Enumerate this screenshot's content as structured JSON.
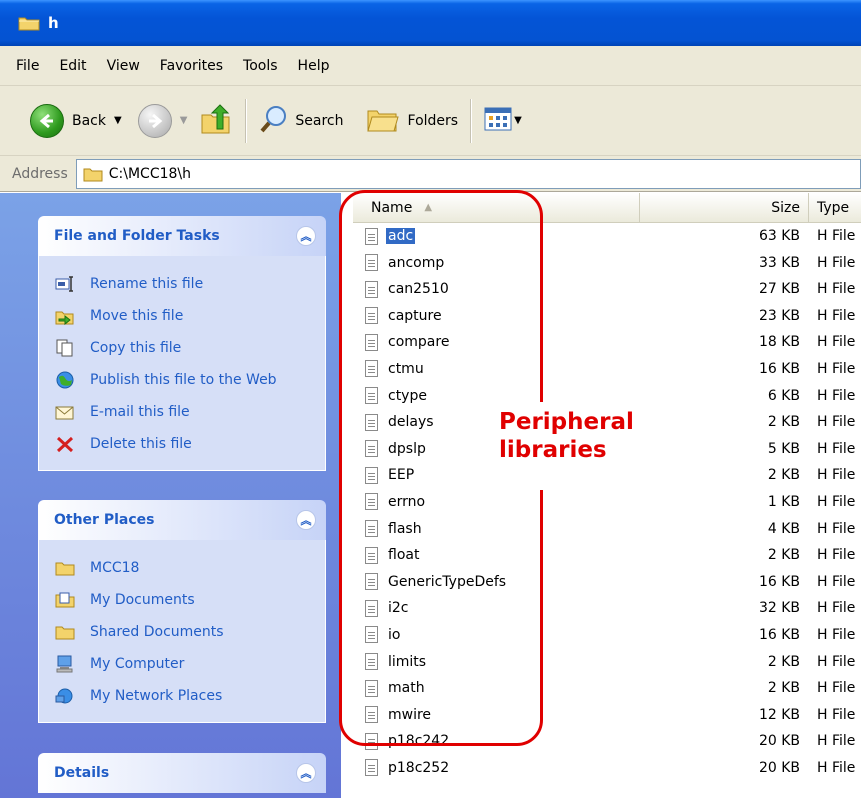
{
  "window": {
    "title": "h"
  },
  "menu": [
    "File",
    "Edit",
    "View",
    "Favorites",
    "Tools",
    "Help"
  ],
  "toolbar": {
    "back": "Back",
    "search": "Search",
    "folders": "Folders"
  },
  "address": {
    "label": "Address",
    "path": "C:\\MCC18\\h"
  },
  "tasks": {
    "title": "File and Folder Tasks",
    "items": [
      {
        "label": "Rename this file",
        "icon": "rename-icon"
      },
      {
        "label": "Move this file",
        "icon": "move-icon"
      },
      {
        "label": "Copy this file",
        "icon": "copy-icon"
      },
      {
        "label": "Publish this file to the Web",
        "icon": "publish-web-icon"
      },
      {
        "label": "E-mail this file",
        "icon": "email-icon"
      },
      {
        "label": "Delete this file",
        "icon": "delete-icon"
      }
    ]
  },
  "places": {
    "title": "Other Places",
    "items": [
      {
        "label": "MCC18",
        "icon": "folder-icon"
      },
      {
        "label": "My Documents",
        "icon": "my-documents-icon"
      },
      {
        "label": "Shared Documents",
        "icon": "folder-icon"
      },
      {
        "label": "My Computer",
        "icon": "computer-icon"
      },
      {
        "label": "My Network Places",
        "icon": "network-icon"
      }
    ]
  },
  "details": {
    "title": "Details"
  },
  "filelist": {
    "columns": {
      "name": "Name",
      "size": "Size",
      "type": "Type"
    },
    "files": [
      {
        "name": "adc",
        "size": "63 KB",
        "type": "H File"
      },
      {
        "name": "ancomp",
        "size": "33 KB",
        "type": "H File"
      },
      {
        "name": "can2510",
        "size": "27 KB",
        "type": "H File"
      },
      {
        "name": "capture",
        "size": "23 KB",
        "type": "H File"
      },
      {
        "name": "compare",
        "size": "18 KB",
        "type": "H File"
      },
      {
        "name": "ctmu",
        "size": "16 KB",
        "type": "H File"
      },
      {
        "name": "ctype",
        "size": "6 KB",
        "type": "H File"
      },
      {
        "name": "delays",
        "size": "2 KB",
        "type": "H File"
      },
      {
        "name": "dpslp",
        "size": "5 KB",
        "type": "H File"
      },
      {
        "name": "EEP",
        "size": "2 KB",
        "type": "H File"
      },
      {
        "name": "errno",
        "size": "1 KB",
        "type": "H File"
      },
      {
        "name": "flash",
        "size": "4 KB",
        "type": "H File"
      },
      {
        "name": "float",
        "size": "2 KB",
        "type": "H File"
      },
      {
        "name": "GenericTypeDefs",
        "size": "16 KB",
        "type": "H File"
      },
      {
        "name": "i2c",
        "size": "32 KB",
        "type": "H File"
      },
      {
        "name": "io",
        "size": "16 KB",
        "type": "H File"
      },
      {
        "name": "limits",
        "size": "2 KB",
        "type": "H File"
      },
      {
        "name": "math",
        "size": "2 KB",
        "type": "H File"
      },
      {
        "name": "mwire",
        "size": "12 KB",
        "type": "H File"
      },
      {
        "name": "p18c242",
        "size": "20 KB",
        "type": "H File"
      },
      {
        "name": "p18c252",
        "size": "20 KB",
        "type": "H File"
      }
    ],
    "selected_index": 0
  },
  "annotation": {
    "line1": "Peripheral",
    "line2": "libraries",
    "color": "#e00000"
  }
}
